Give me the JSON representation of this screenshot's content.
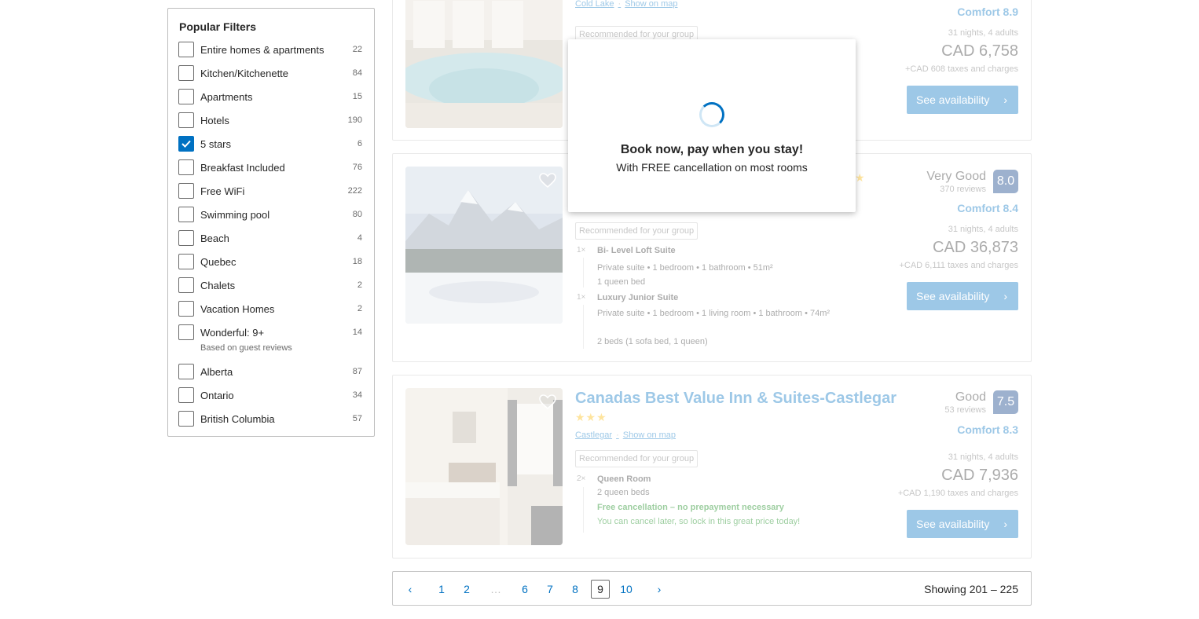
{
  "filters": {
    "title": "Popular Filters",
    "items": [
      {
        "label": "Entire homes & apartments",
        "count": "22",
        "checked": false
      },
      {
        "label": "Kitchen/Kitchenette",
        "count": "84",
        "checked": false
      },
      {
        "label": "Apartments",
        "count": "15",
        "checked": false
      },
      {
        "label": "Hotels",
        "count": "190",
        "checked": false
      },
      {
        "label": "5 stars",
        "count": "6",
        "checked": true
      },
      {
        "label": "Breakfast Included",
        "count": "76",
        "checked": false
      },
      {
        "label": "Free WiFi",
        "count": "222",
        "checked": false
      },
      {
        "label": "Swimming pool",
        "count": "80",
        "checked": false
      },
      {
        "label": "Beach",
        "count": "4",
        "checked": false
      },
      {
        "label": "Quebec",
        "count": "18",
        "checked": false
      },
      {
        "label": "Chalets",
        "count": "2",
        "checked": false
      },
      {
        "label": "Vacation Homes",
        "count": "2",
        "checked": false
      },
      {
        "label": "Wonderful: 9+",
        "count": "14",
        "checked": false
      },
      {
        "label": "Alberta",
        "count": "87",
        "checked": false
      },
      {
        "label": "Ontario",
        "count": "34",
        "checked": false
      },
      {
        "label": "British Columbia",
        "count": "57",
        "checked": false
      }
    ],
    "wonderful_note": "Based on guest reviews"
  },
  "results": {
    "card1": {
      "location": "Cold Lake",
      "show_on_map": "Show on map",
      "comfort": "Comfort 8.9",
      "recommended": "Recommended for your group",
      "nights": "31 nights, 4 adults",
      "price": "CAD 6,758",
      "taxes": "+CAD 608 taxes and charges",
      "button": "See availability"
    },
    "card2": {
      "score_word": "Very Good",
      "reviews": "370 reviews",
      "score": "8.0",
      "comfort": "Comfort 8.4",
      "recommended": "Recommended for your group",
      "room1_qty": "1×",
      "room1_name": "Bi- Level Loft Suite",
      "room1_desc": "Private suite • 1 bedroom • 1 bathroom • 51m²",
      "room1_beds": "1 queen bed",
      "room2_qty": "1×",
      "room2_name": "Luxury Junior Suite",
      "room2_desc": "Private suite • 1 bedroom • 1 living room • 1 bathroom • 74m²",
      "room2_beds": "2 beds (1 sofa bed, 1 queen)",
      "nights": "31 nights, 4 adults",
      "price": "CAD 36,873",
      "taxes": "+CAD 6,111 taxes and charges",
      "button": "See availability"
    },
    "card3": {
      "name": "Canadas Best Value Inn & Suites-Castlegar",
      "stars": "★★★",
      "location": "Castlegar",
      "show_on_map": "Show on map",
      "score_word": "Good",
      "reviews": "53 reviews",
      "score": "7.5",
      "comfort": "Comfort 8.3",
      "recommended": "Recommended for your group",
      "room_qty": "2×",
      "room_name": "Queen Room",
      "room_beds": "2 queen beds",
      "free_cancel": "Free cancellation – no prepayment necessary",
      "cancel_later": "You can cancel later, so lock in this great price today!",
      "nights": "31 nights, 4 adults",
      "price": "CAD 7,936",
      "taxes": "+CAD 1,190 taxes and charges",
      "button": "See availability"
    }
  },
  "pagination": {
    "prev": "‹",
    "pages": [
      "1",
      "2",
      "…",
      "6",
      "7",
      "8",
      "9",
      "10"
    ],
    "current": "9",
    "next": "›",
    "showing": "Showing 201 – 225"
  },
  "modal": {
    "title": "Book now, pay when you stay!",
    "subtitle": "With FREE cancellation on most rooms"
  },
  "colors": {
    "accent": "#0071c2",
    "score_badge": "#003580",
    "stars": "#febb02",
    "green": "#008009"
  }
}
